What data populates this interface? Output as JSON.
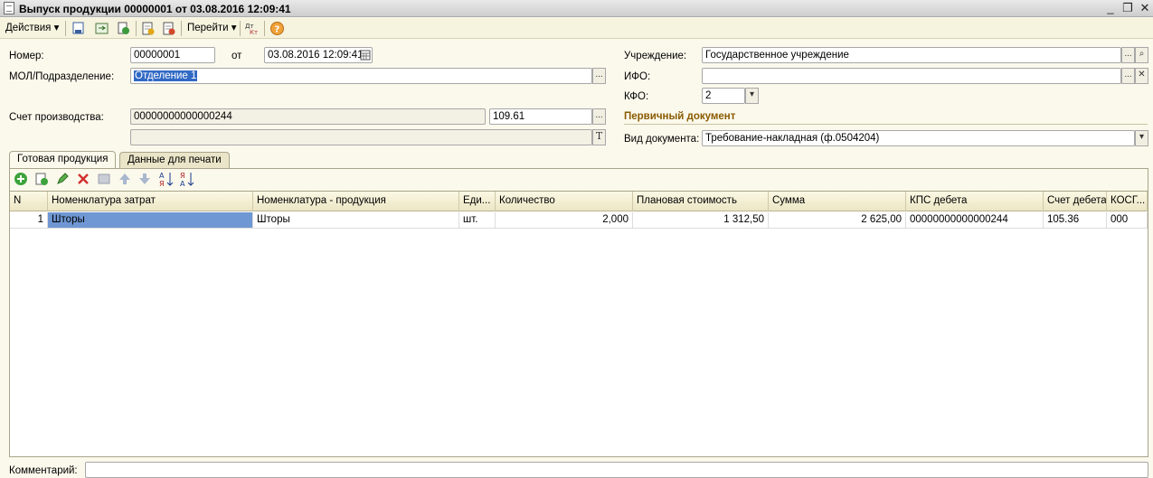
{
  "window": {
    "title": "Выпуск продукции 00000001 от 03.08.2016 12:09:41"
  },
  "toolbar": {
    "actions_label": "Действия",
    "goto_label": "Перейти",
    "icons": [
      "save-post-icon",
      "refresh-icon",
      "copy-icon",
      "post-icon",
      "unpost-icon",
      "journal-icon",
      "help-icon"
    ]
  },
  "form": {
    "number_label": "Номер:",
    "number_value": "00000001",
    "from_label": "от",
    "date_value": "03.08.2016 12:09:41",
    "mol_label": "МОЛ/Подразделение:",
    "mol_value": "Отделение 1",
    "prod_account_label": "Счет производства:",
    "prod_account_kps": "00000000000000244",
    "prod_account_value": "109.61",
    "institution_label": "Учреждение:",
    "institution_value": "Государственное учреждение",
    "ifo_label": "ИФО:",
    "ifo_value": "",
    "kfo_label": "КФО:",
    "kfo_value": "2",
    "primary_doc_label": "Первичный документ",
    "doc_type_label": "Вид документа:",
    "doc_type_value": "Требование-накладная (ф.0504204)",
    "comment_label": "Комментарий:",
    "comment_value": ""
  },
  "tabs": [
    {
      "label": "Готовая продукция"
    },
    {
      "label": "Данные для печати"
    }
  ],
  "grid": {
    "columns": [
      "N",
      "Номенклатура затрат",
      "Номенклатура - продукция",
      "Еди...",
      "Количество",
      "Плановая стоимость",
      "Сумма",
      "КПС дебета",
      "Счет дебета",
      "КОСГ..."
    ],
    "rows": [
      {
        "n": "1",
        "cost_item": "Шторы",
        "product": "Шторы",
        "unit": "шт.",
        "qty": "2,000",
        "plan_cost": "1 312,50",
        "sum": "2 625,00",
        "kps": "00000000000000244",
        "account": "105.36",
        "kosgu": "000"
      }
    ]
  },
  "colors": {
    "accent": "#316ac5",
    "section": "#8a5b00",
    "bg": "#fbf9ec"
  }
}
